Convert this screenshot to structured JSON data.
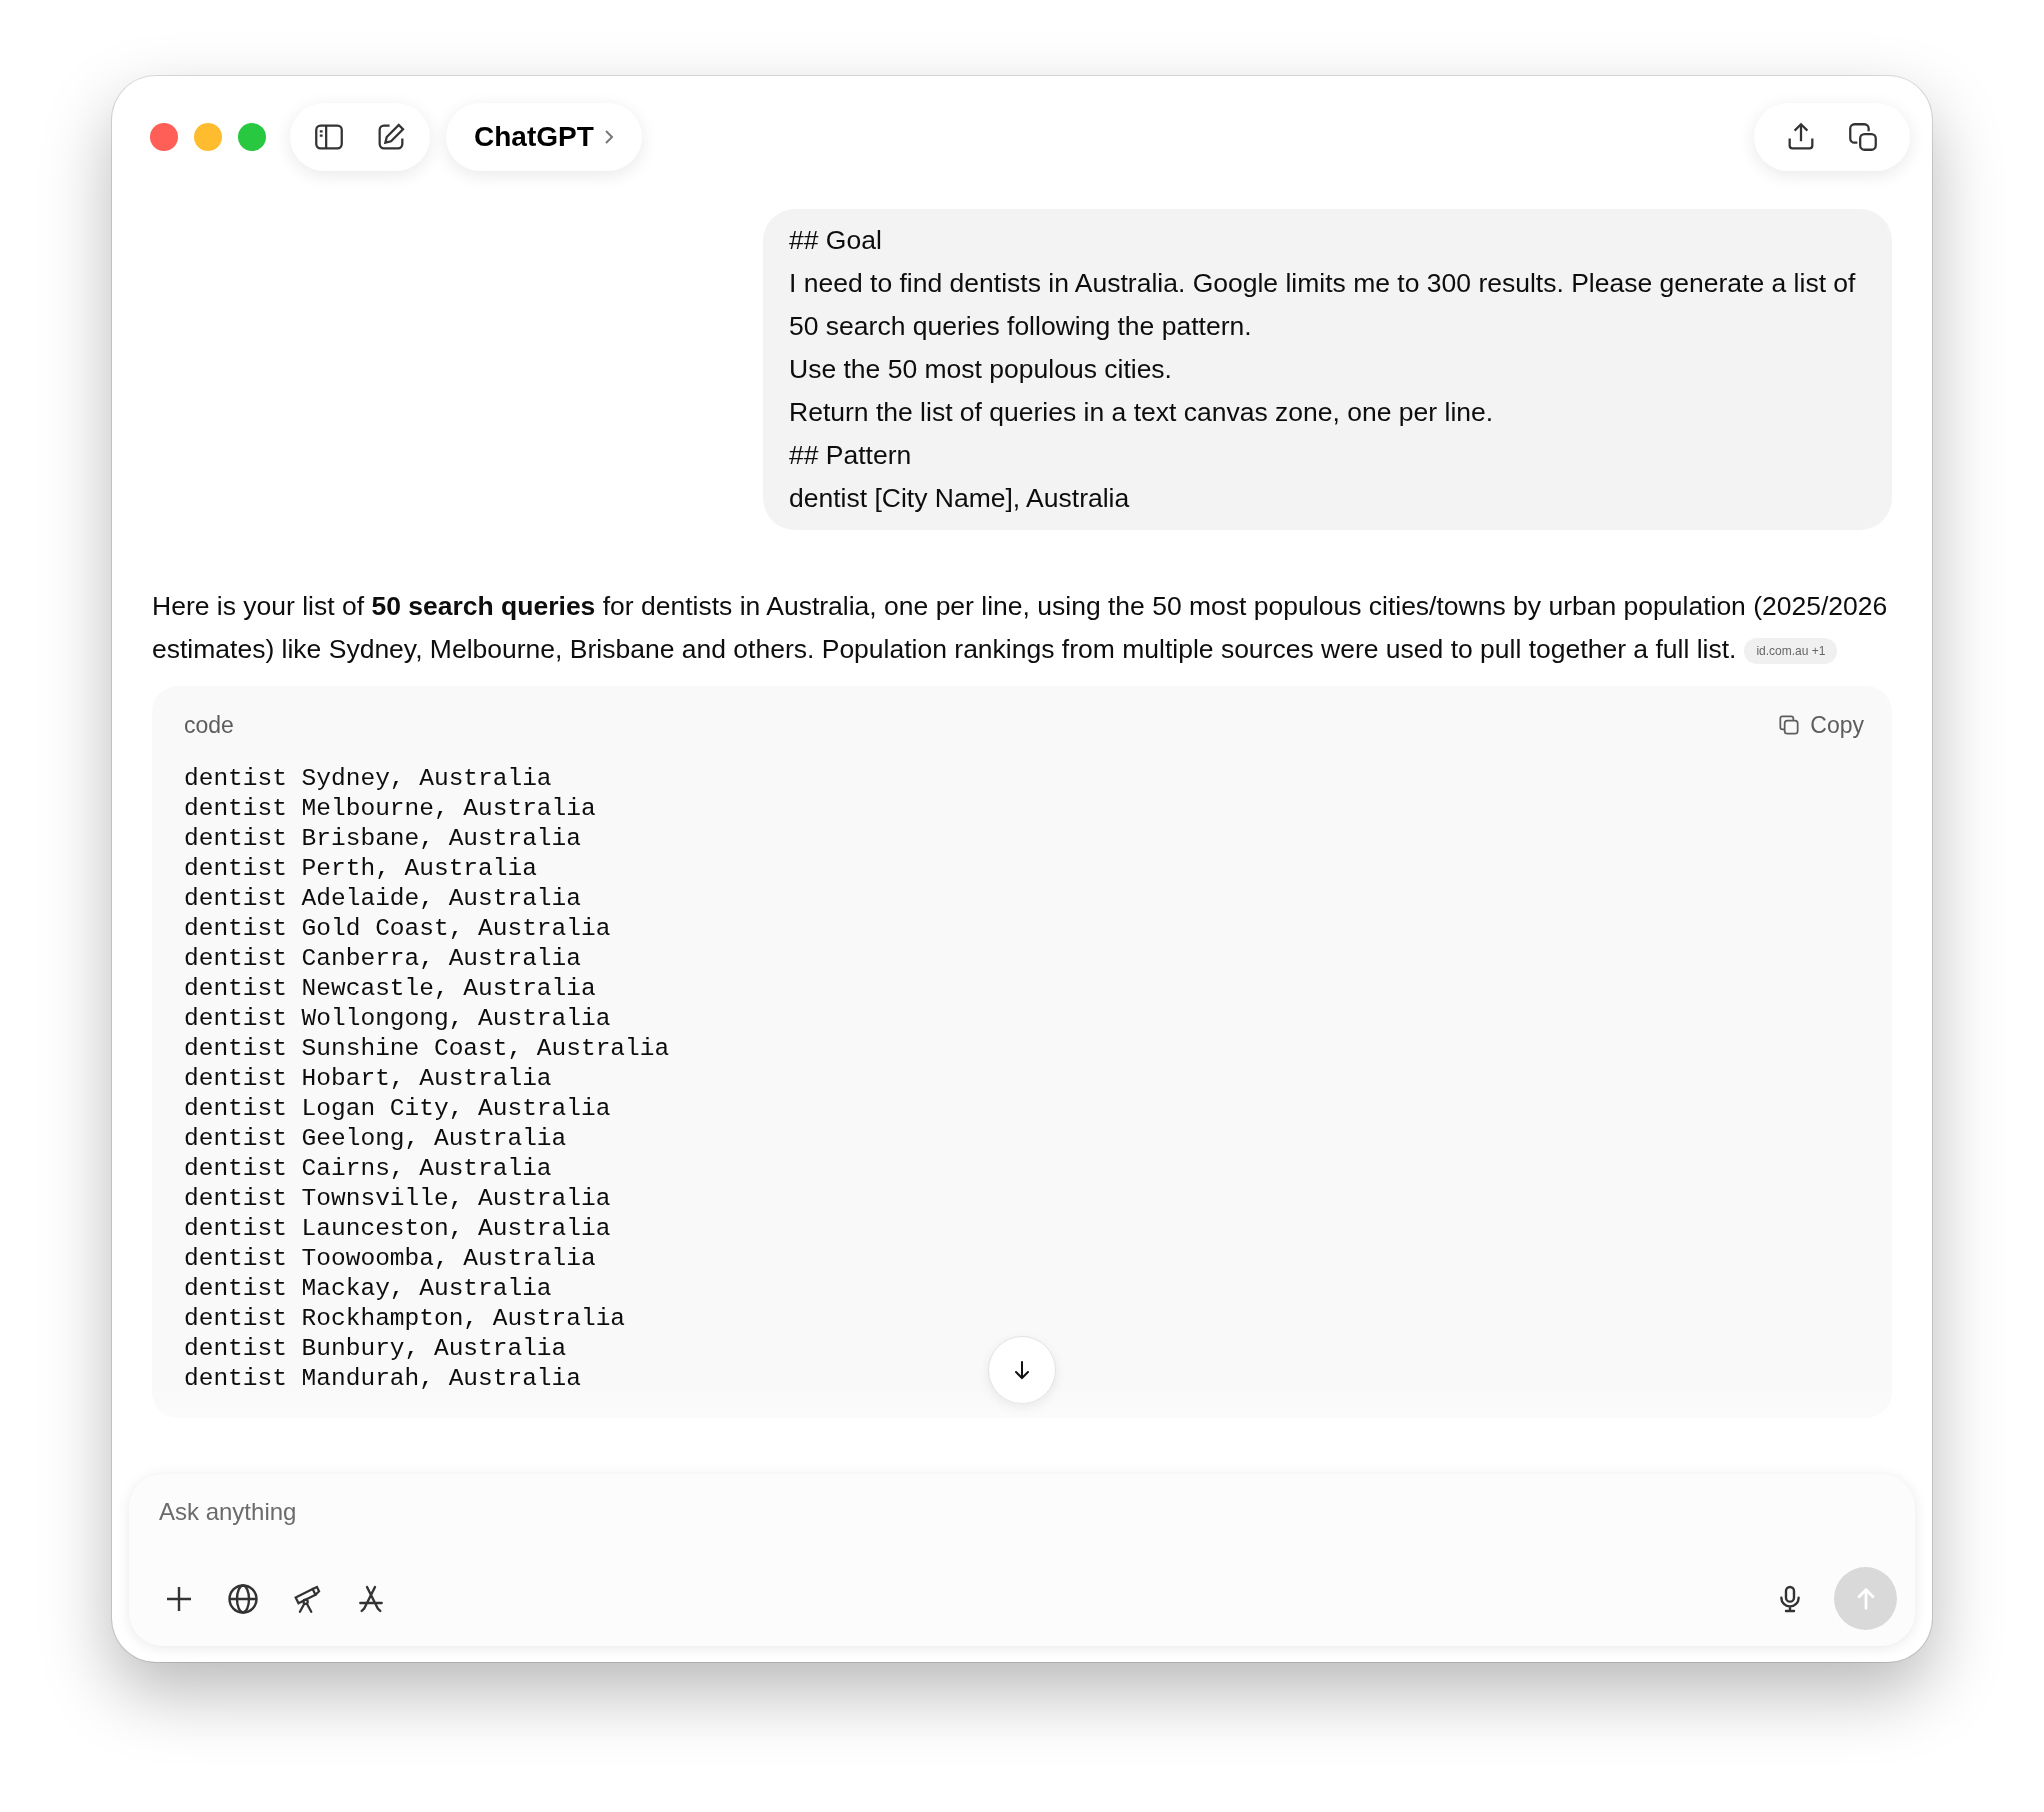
{
  "window": {
    "traffic_lights": [
      {
        "color": "#ff5f57"
      },
      {
        "color": "#febc2e"
      },
      {
        "color": "#28c840"
      }
    ]
  },
  "header": {
    "title": "ChatGPT"
  },
  "user_message": {
    "lines": [
      "## Goal",
      "I need to find dentists in Australia. Google limits me to 300 results. Please generate a list of 50 search queries following the pattern.",
      "Use the 50 most populous cities.",
      "Return the list of queries in a text canvas zone, one per line.",
      "## Pattern",
      "dentist [City Name], Australia"
    ]
  },
  "assistant_message": {
    "text": "Here is your list of **50 search queries** for dentists in Australia, one per line, using the 50 most populous cities/towns by urban population (2025/2026 estimates) like Sydney, Melbourne, Brisbane and others. Population rankings from multiple sources were used to pull together a full list.",
    "citation": "id.com.au +1"
  },
  "code_block": {
    "language": "code",
    "copy_label": "Copy",
    "lines": [
      "dentist Sydney, Australia",
      "dentist Melbourne, Australia",
      "dentist Brisbane, Australia",
      "dentist Perth, Australia",
      "dentist Adelaide, Australia",
      "dentist Gold Coast, Australia",
      "dentist Canberra, Australia",
      "dentist Newcastle, Australia",
      "dentist Wollongong, Australia",
      "dentist Sunshine Coast, Australia",
      "dentist Hobart, Australia",
      "dentist Logan City, Australia",
      "dentist Geelong, Australia",
      "dentist Cairns, Australia",
      "dentist Townsville, Australia",
      "dentist Launceston, Australia",
      "dentist Toowoomba, Australia",
      "dentist Mackay, Australia",
      "dentist Rockhampton, Australia",
      "dentist Bunbury, Australia",
      "dentist Mandurah, Australia"
    ]
  },
  "composer": {
    "placeholder": "Ask anything"
  }
}
